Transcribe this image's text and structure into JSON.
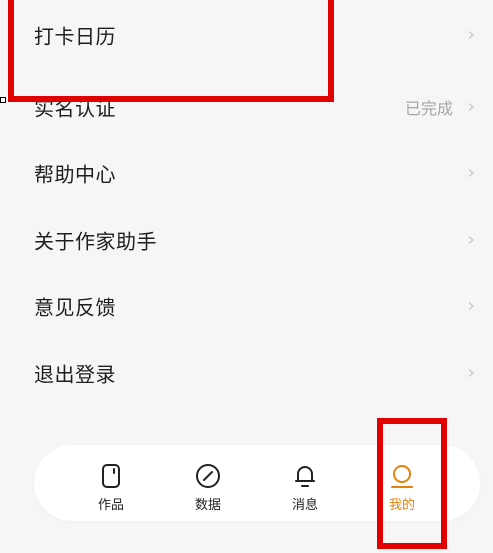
{
  "menu": {
    "items": [
      {
        "label": "打卡日历",
        "value": ""
      },
      {
        "label": "实名认证",
        "value": "已完成"
      },
      {
        "label": "帮助中心",
        "value": ""
      },
      {
        "label": "关于作家助手",
        "value": ""
      },
      {
        "label": "意见反馈",
        "value": ""
      },
      {
        "label": "退出登录",
        "value": ""
      }
    ],
    "chevron": "›"
  },
  "tabbar": {
    "items": [
      {
        "label": "作品",
        "icon": "works-icon"
      },
      {
        "label": "数据",
        "icon": "data-compass-icon"
      },
      {
        "label": "消息",
        "icon": "bell-icon"
      },
      {
        "label": "我的",
        "icon": "profile-icon",
        "active": true
      }
    ]
  },
  "colors": {
    "accent": "#e5820f",
    "annotation": "#e00000",
    "background": "#f6f6f6"
  }
}
